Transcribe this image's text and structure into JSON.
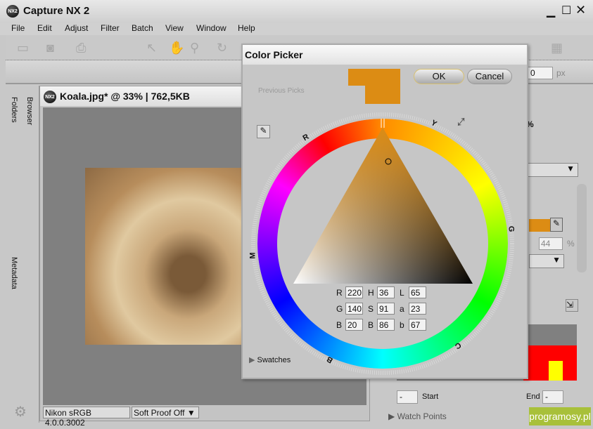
{
  "app": {
    "title": "Capture NX 2",
    "logo": "NX2"
  },
  "menu": [
    "File",
    "Edit",
    "Adjust",
    "Filter",
    "Batch",
    "View",
    "Window",
    "Help"
  ],
  "left_tabs": {
    "folders": "Folders",
    "browser": "Browser",
    "metadata": "Metadata"
  },
  "document": {
    "title": "Koala.jpg* @ 33% | 762,5KB",
    "profile": "Nikon sRGB 4.0.0.3002",
    "soft_proof": "Soft Proof Off"
  },
  "toolbar2": {
    "value": "0",
    "unit": "px"
  },
  "right_panel": {
    "percent_sign": "%",
    "opacity_value": "44",
    "start_label": "Start",
    "start_value": "-",
    "end_label": "End",
    "end_value": "-",
    "watch_points": "Watch Points",
    "swatch_color": "#dc8c14"
  },
  "dialog": {
    "title": "Color Picker",
    "previous_picks": "Previous Picks",
    "ok": "OK",
    "cancel": "Cancel",
    "swatches": "Swatches",
    "current_color": "#dc8c14",
    "wheel_labels": [
      "R",
      "Y",
      "G",
      "C",
      "B",
      "M"
    ],
    "rgb": {
      "R": "220",
      "G": "140",
      "B": "20"
    },
    "hsb": {
      "H": "36",
      "S": "91",
      "B": "86"
    },
    "lab": {
      "L": "65",
      "a": "23",
      "b": "67"
    }
  },
  "watermark": "programosy.pl"
}
